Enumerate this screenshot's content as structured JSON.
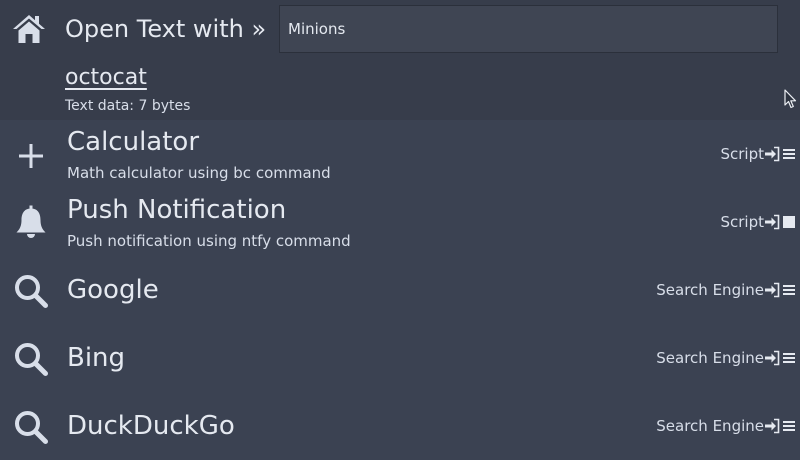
{
  "header": {
    "icon": "home-icon",
    "title": "Open Text with »",
    "search_value": "Minions",
    "input_name": "octocat",
    "input_info": "Text data: 7 bytes"
  },
  "items": [
    {
      "icon": "plus-icon",
      "title": "Calculator",
      "description": "Math calculator using bc command",
      "type": "Script",
      "action_icons": [
        "enter-icon",
        "menu-icon"
      ]
    },
    {
      "icon": "bell-icon",
      "title": "Push Notification",
      "description": "Push notification using ntfy command",
      "type": "Script",
      "action_icons": [
        "enter-icon",
        "square-icon"
      ]
    },
    {
      "icon": "search-icon",
      "title": "Google",
      "description": "",
      "type": "Search Engine",
      "action_icons": [
        "enter-icon",
        "menu-icon"
      ]
    },
    {
      "icon": "search-icon",
      "title": "Bing",
      "description": "",
      "type": "Search Engine",
      "action_icons": [
        "enter-icon",
        "menu-icon"
      ]
    },
    {
      "icon": "search-icon",
      "title": "DuckDuckGo",
      "description": "",
      "type": "Search Engine",
      "action_icons": [
        "enter-icon",
        "menu-icon"
      ]
    }
  ],
  "colors": {
    "background": "#3b4252",
    "header_background": "#373d4b",
    "text": "#e5e9f0"
  }
}
